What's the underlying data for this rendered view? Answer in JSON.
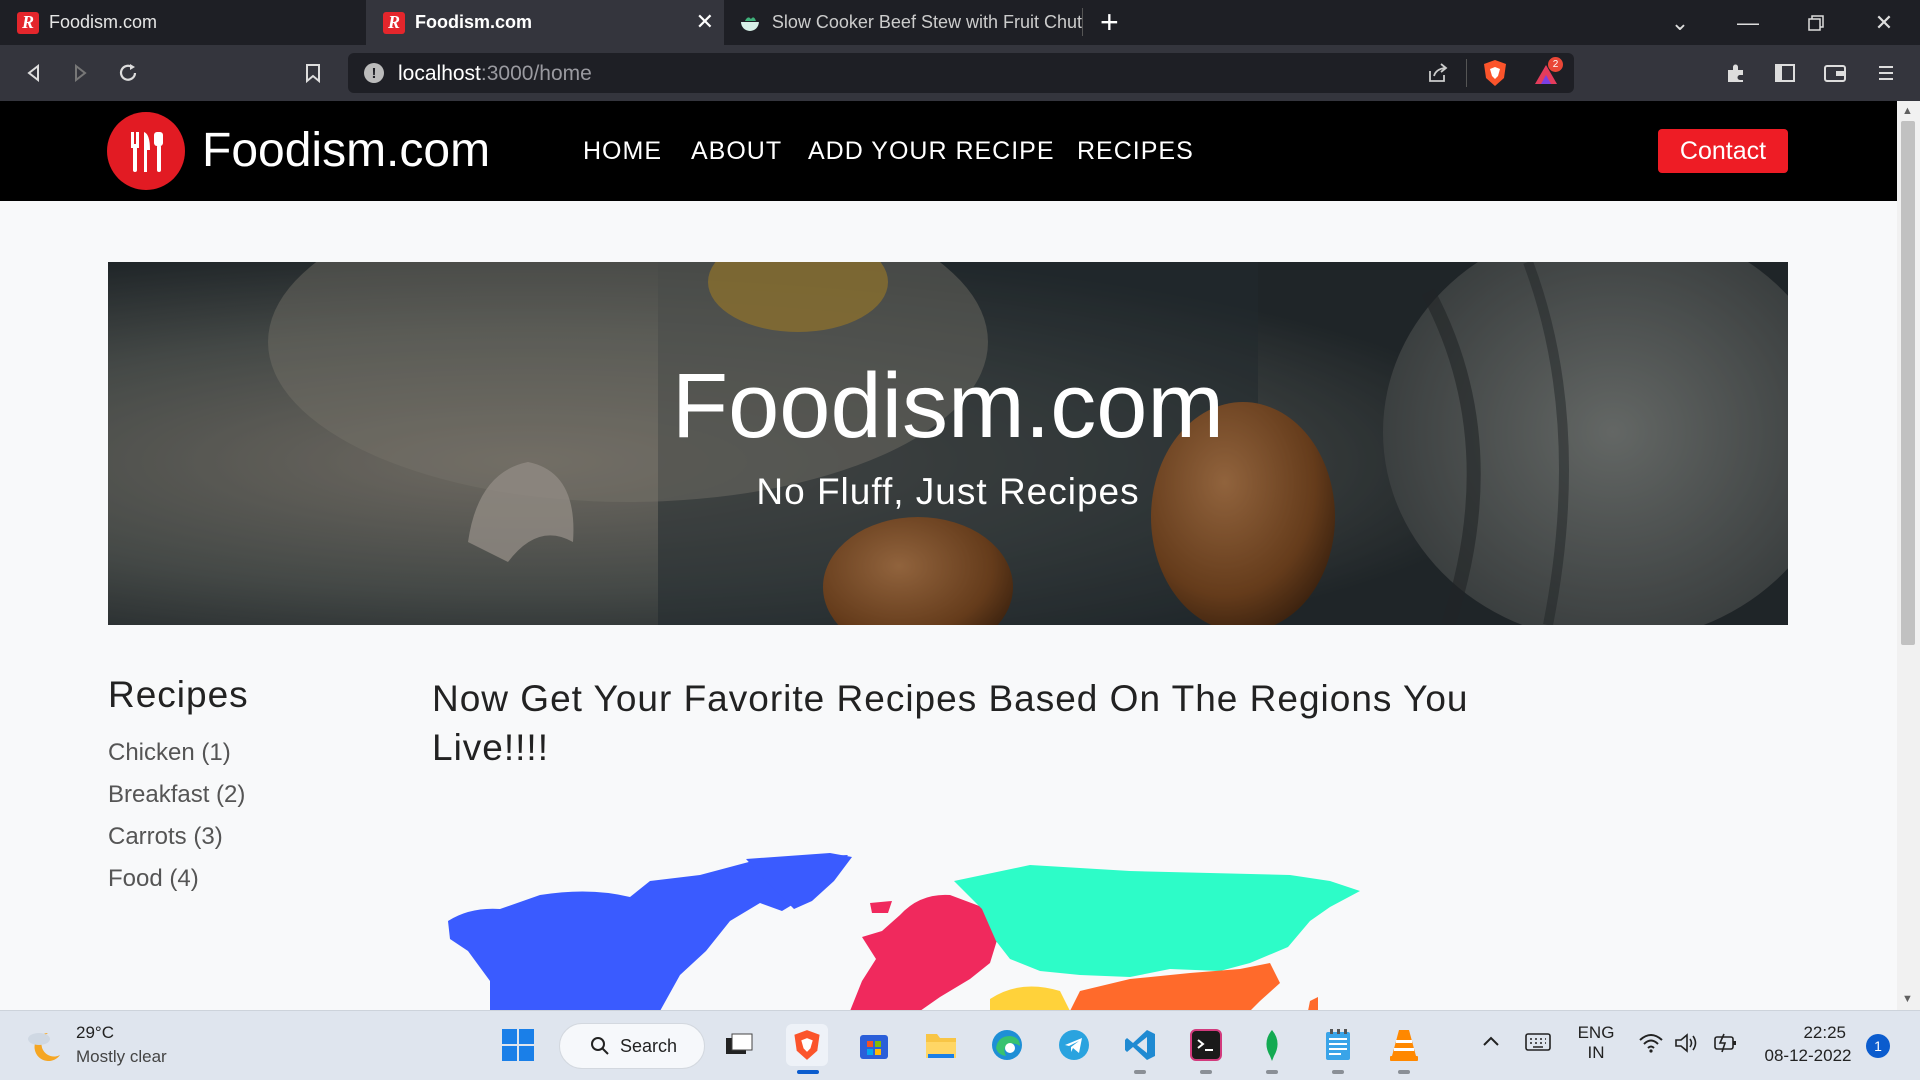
{
  "browser": {
    "tabs": [
      {
        "title": "Foodism.com",
        "favicon": "R"
      },
      {
        "title": "Foodism.com",
        "favicon": "R"
      },
      {
        "title": "Slow Cooker Beef Stew with Fruit Chut"
      }
    ],
    "url_host": "localhost",
    "url_path": ":3000/home",
    "shields_badge": "2"
  },
  "site": {
    "brand": "Foodism.com",
    "nav": [
      "HOME",
      "ABOUT",
      "ADD YOUR RECIPE",
      "RECIPES"
    ],
    "contact_label": "Contact",
    "hero_title": "Foodism.com",
    "hero_subtitle": "No Fluff, Just Recipes",
    "sidebar_heading": "Recipes",
    "categories": [
      "Chicken (1)",
      "Breakfast (2)",
      "Carrots (3)",
      "Food (4)"
    ],
    "main_heading": "Now Get Your Favorite Recipes Based On The Regions You Live!!!!"
  },
  "map_colors": {
    "north_america": "#3a5bff",
    "europe": "#f0295d",
    "russia": "#2dfcc8",
    "asia_south": "#ff6a2b",
    "middle_east": "#ffd23a"
  },
  "taskbar": {
    "temperature": "29°C",
    "weather": "Mostly clear",
    "search_label": "Search",
    "lang1": "ENG",
    "lang2": "IN",
    "time": "22:25",
    "date": "08-12-2022",
    "notifications": "1"
  },
  "accent": "#e21b23"
}
